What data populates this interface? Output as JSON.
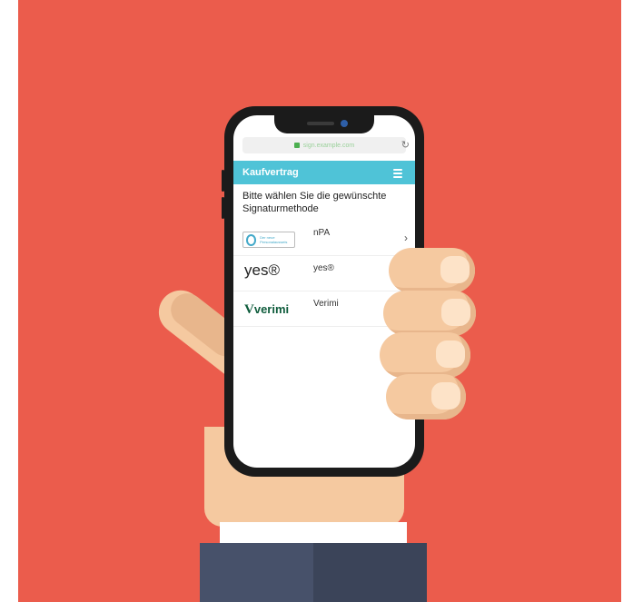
{
  "browser": {
    "url": "sign.example.com",
    "reload_icon": "reload-icon"
  },
  "app": {
    "title": "Kaufvertrag",
    "menu_icon": "hamburger-menu-icon",
    "prompt": "Bitte wählen Sie die gewünschte Signaturmethode"
  },
  "options": [
    {
      "logo_text": "Der neue Personalausweis",
      "name": "nPA",
      "has_chevron": true
    },
    {
      "logo_text": "yes®",
      "name": "yes®",
      "has_chevron": false
    },
    {
      "logo_text": "verimi",
      "name": "Verimi",
      "has_chevron": false
    }
  ],
  "colors": {
    "background": "#eb5c4c",
    "header": "#4fc3d7",
    "skin": "#f5c9a0",
    "sleeve": "#47516a"
  }
}
